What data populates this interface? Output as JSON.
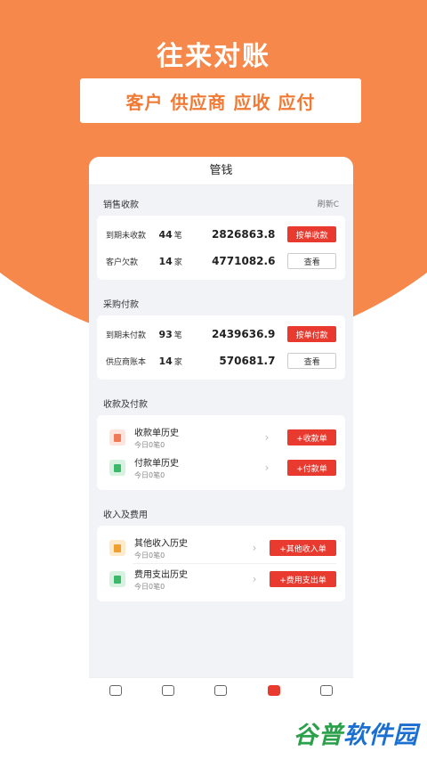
{
  "hero": {
    "title": "往来对账",
    "subtitle": "客户 供应商 应收 应付"
  },
  "header": {
    "title": "管钱"
  },
  "sales": {
    "title": "销售收款",
    "refresh": "刷新C",
    "rows": [
      {
        "label": "到期未收款",
        "count": "44",
        "unit": "笔",
        "amount": "2826863.8",
        "button": "按单收款"
      },
      {
        "label": "客户欠款",
        "count": "14",
        "unit": "家",
        "amount": "4771082.6",
        "button": "查看"
      }
    ]
  },
  "purchase": {
    "title": "采购付款",
    "rows": [
      {
        "label": "到期未付款",
        "count": "93",
        "unit": "笔",
        "amount": "2439636.9",
        "button": "按单付款"
      },
      {
        "label": "供应商账本",
        "count": "14",
        "unit": "家",
        "amount": "570681.7",
        "button": "查看"
      }
    ]
  },
  "receipts": {
    "title": "收款及付款",
    "items": [
      {
        "name": "收款单历史",
        "sub": "今日0笔0",
        "button": "+收款单",
        "icon": "receipt-doc-icon",
        "color": "#f07a55"
      },
      {
        "name": "付款单历史",
        "sub": "今日0笔0",
        "button": "+付款单",
        "icon": "payment-doc-icon",
        "color": "#3cb86a"
      }
    ]
  },
  "income": {
    "title": "收入及费用",
    "items": [
      {
        "name": "其他收入历史",
        "sub": "今日0笔0",
        "button": "+其他收入单",
        "icon": "income-doc-icon",
        "color": "#f0a030"
      },
      {
        "name": "费用支出历史",
        "sub": "今日0笔0",
        "button": "+费用支出单",
        "icon": "chart-bar-icon",
        "color": "#3cb86a"
      }
    ]
  },
  "tabs": [
    {
      "icon": "home-icon"
    },
    {
      "icon": "trend-icon"
    },
    {
      "icon": "list-icon"
    },
    {
      "icon": "wallet-icon",
      "active": true
    },
    {
      "icon": "report-icon"
    }
  ],
  "watermark": {
    "part1": "谷",
    "part2": "普",
    "part3": "软件园"
  }
}
